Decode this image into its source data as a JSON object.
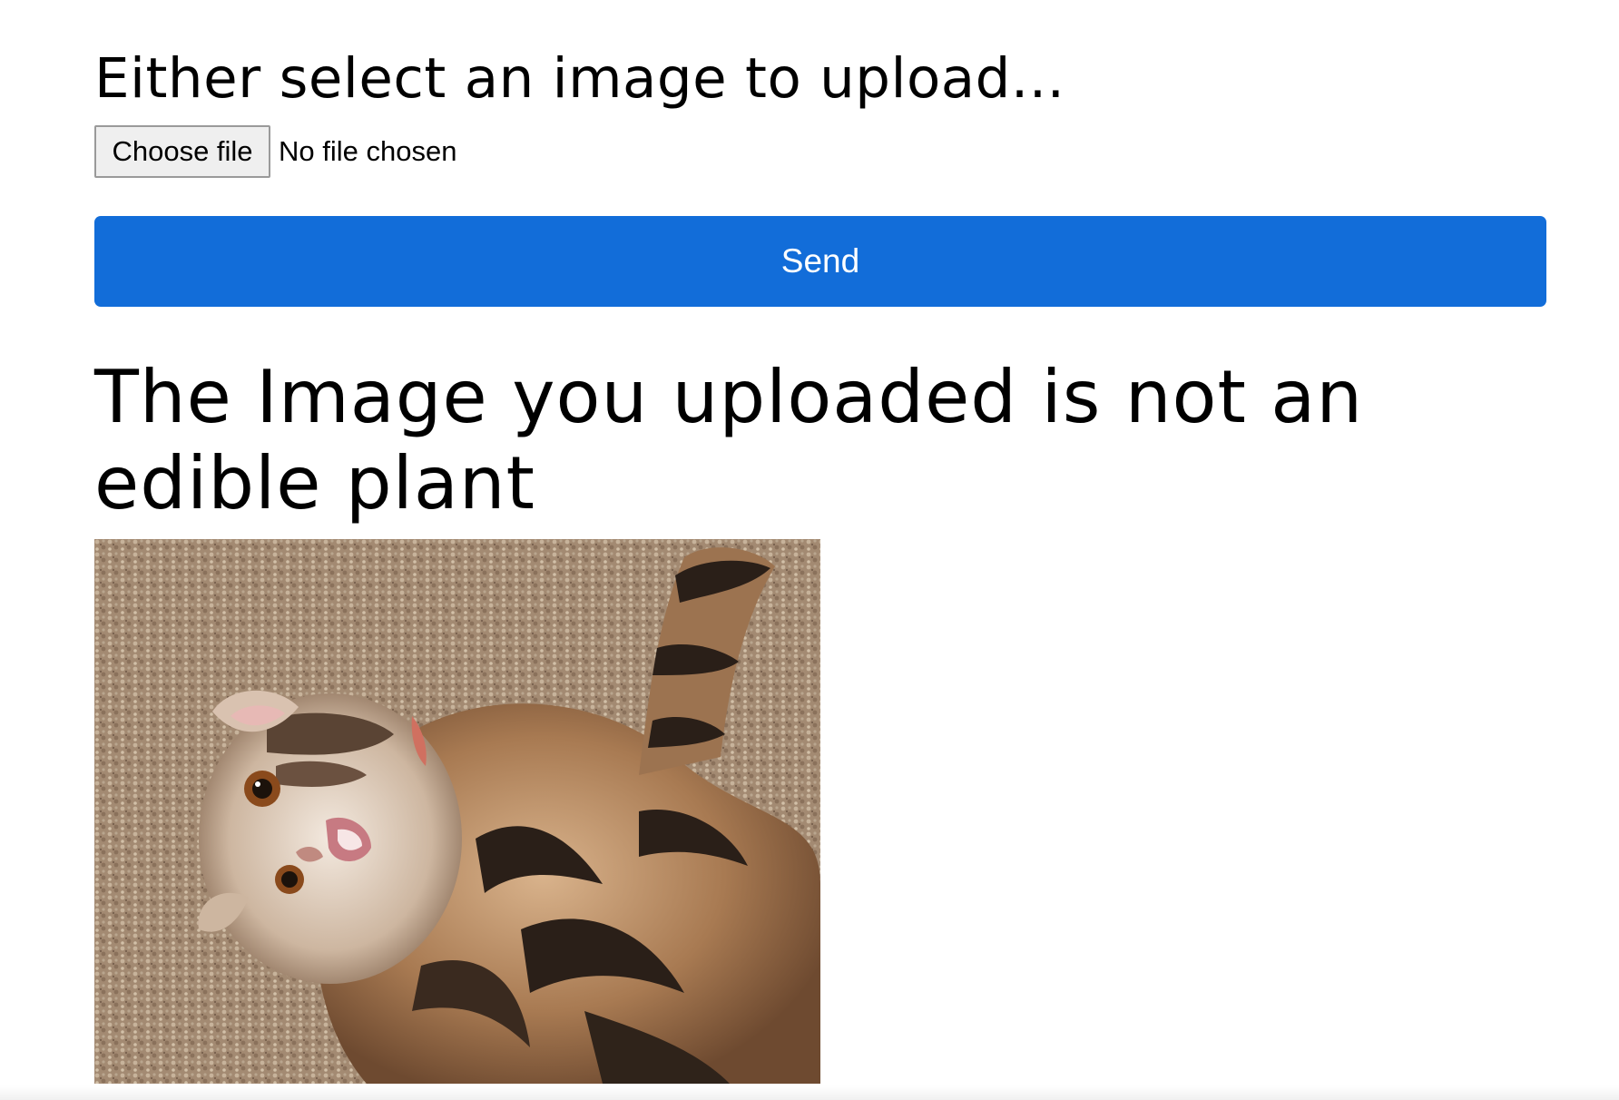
{
  "upload": {
    "heading": "Either select an image to upload...",
    "choose_file_label": "Choose file",
    "file_status": "No file chosen"
  },
  "send_button": {
    "label": "Send",
    "color": "#126dd9"
  },
  "result": {
    "message": "The Image you uploaded is not an edible plant",
    "image_subject": "tabby kitten lying on its back on a beige carpet"
  }
}
